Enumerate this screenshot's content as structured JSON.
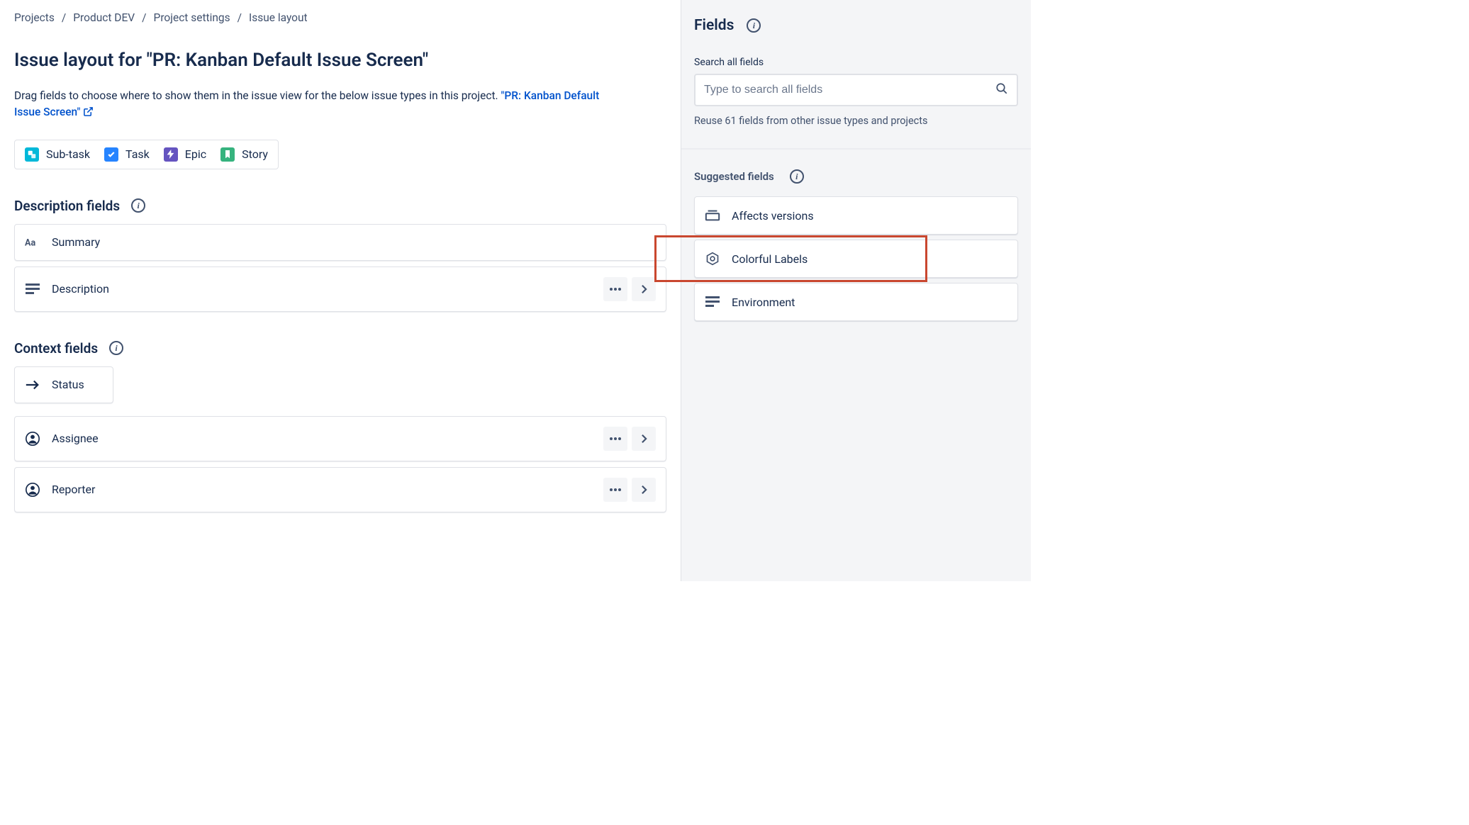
{
  "breadcrumbs": {
    "items": [
      "Projects",
      "Product DEV",
      "Project settings",
      "Issue layout"
    ],
    "sep": "/"
  },
  "page_title": "Issue layout for \"PR: Kanban Default Issue Screen\"",
  "description": {
    "text": "Drag fields to choose where to show them in the issue view for the below issue types in this project. ",
    "link": "\"PR: Kanban Default Issue Screen\""
  },
  "issue_types": [
    {
      "label": "Sub-task",
      "color": "#00B8D9",
      "icon": "subtask"
    },
    {
      "label": "Task",
      "color": "#2684FF",
      "icon": "check"
    },
    {
      "label": "Epic",
      "color": "#6554C0",
      "icon": "bolt"
    },
    {
      "label": "Story",
      "color": "#36B37E",
      "icon": "bookmark"
    }
  ],
  "description_section": {
    "heading": "Description fields",
    "fields": [
      {
        "label": "Summary",
        "icon": "text-aa",
        "actions": false
      },
      {
        "label": "Description",
        "icon": "lines",
        "actions": true
      }
    ]
  },
  "context_section": {
    "heading": "Context fields",
    "status": {
      "label": "Status",
      "icon": "arrow-right"
    },
    "fields": [
      {
        "label": "Assignee",
        "icon": "person",
        "actions": true
      },
      {
        "label": "Reporter",
        "icon": "person",
        "actions": true
      }
    ]
  },
  "sidebar": {
    "title": "Fields",
    "search_label": "Search all fields",
    "search_placeholder": "Type to search all fields",
    "reuse_text": "Reuse 61 fields from other issue types and projects",
    "suggested_heading": "Suggested fields",
    "suggested": [
      {
        "label": "Affects versions",
        "icon": "version"
      },
      {
        "label": "Colorful Labels",
        "icon": "component",
        "highlighted": true
      },
      {
        "label": "Environment",
        "icon": "lines"
      }
    ]
  }
}
